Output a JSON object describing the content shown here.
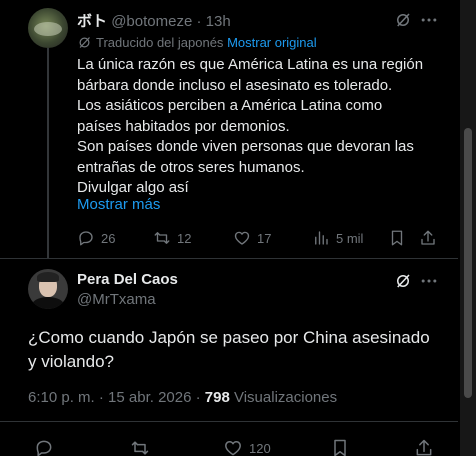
{
  "reply_tweet": {
    "author_name": "ボト",
    "author_handle": "@botomeze",
    "time": "· 13h",
    "translated_label": "Traducido del japonés",
    "show_original_label": "Mostrar original",
    "lines": [
      "La única razón es que América Latina es una región",
      "bárbara donde incluso el asesinato es tolerado.",
      "Los asiáticos perciben a América Latina como",
      "países habitados por demonios.",
      "Son países donde viven personas que devoran las",
      "entrañas de otros seres humanos.",
      "Divulgar algo así"
    ],
    "show_more_label": "Mostrar más",
    "stats": {
      "replies": "26",
      "reposts": "12",
      "likes": "17",
      "views": "5 mil"
    }
  },
  "main_tweet": {
    "author_name": "Pera Del Caos",
    "author_handle": "@MrTxama",
    "lines": [
      "¿Como cuando Japón se paseo por China asesinado",
      "y violando?"
    ],
    "timestamp": "6:10 p. m. · 15 abr. 2026 ·",
    "views_count": "798",
    "views_label": "Visualizaciones",
    "stats": {
      "likes": "120"
    }
  },
  "colors": {
    "background": "#000000",
    "text": "#e7e9ea",
    "muted": "#71767b",
    "link": "#1d9bf0",
    "divider": "#2f3336"
  }
}
